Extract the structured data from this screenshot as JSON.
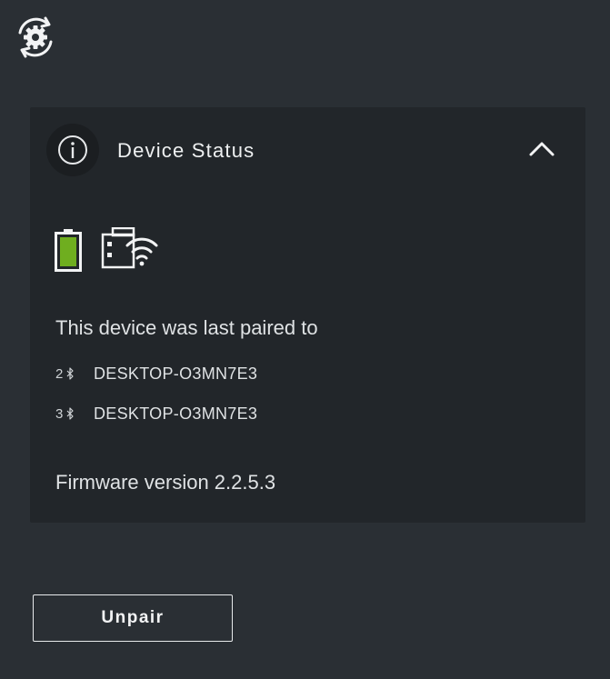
{
  "toolbar": {
    "settings_icon": "settings-sync-icon"
  },
  "card": {
    "title": "Device Status",
    "info_icon": "info-icon",
    "collapse_icon": "chevron-up-icon",
    "battery": {
      "icon": "battery-icon",
      "level": 1.0,
      "color": "#6fae1f"
    },
    "receiver_icon": "wireless-receiver-icon",
    "paired_label": "This device was last paired to",
    "paired_devices": [
      {
        "channel": "2",
        "icon": "bluetooth-icon",
        "name": "DESKTOP-O3MN7E3"
      },
      {
        "channel": "3",
        "icon": "bluetooth-icon",
        "name": "DESKTOP-O3MN7E3"
      }
    ],
    "firmware": "Firmware version 2.2.5.3"
  },
  "actions": {
    "unpair_label": "Unpair"
  },
  "colors": {
    "background": "#2a2f34",
    "card": "#22262a",
    "text": "#dfe2e4"
  }
}
